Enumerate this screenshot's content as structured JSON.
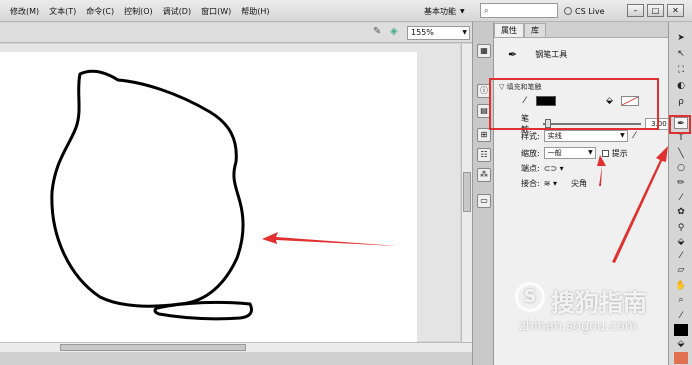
{
  "menu": {
    "items": [
      "修改(M)",
      "文本(T)",
      "命令(C)",
      "控制(O)",
      "调试(D)",
      "窗口(W)",
      "帮助(H)"
    ]
  },
  "header": {
    "workspace_label": "基本功能",
    "cs_live": "CS Live",
    "window_buttons": [
      "–",
      "□",
      "✕"
    ]
  },
  "editbar": {
    "zoom_value": "155%"
  },
  "properties_panel": {
    "tabs": [
      "属性",
      "库"
    ],
    "tool_name": "钢笔工具",
    "section_fill_stroke": "填充和笔触",
    "stroke_label": "笔触:",
    "stroke_value": "3.00",
    "style_label": "样式:",
    "style_value": "实线",
    "scale_label": "缩放:",
    "scale_value": "一般",
    "hint_label": "提示",
    "cap_label": "端点:",
    "join_label": "接合:",
    "join_value": "尖角",
    "stroke_color": "#000000",
    "fill_color": "none"
  },
  "watermark": {
    "title": "搜狗指南",
    "url": "zhinan.sogou.com"
  },
  "colors": {
    "annotation_red": "#e03030",
    "stage_bg": "#ffffff",
    "chrome_bg": "#d4d4d4"
  }
}
